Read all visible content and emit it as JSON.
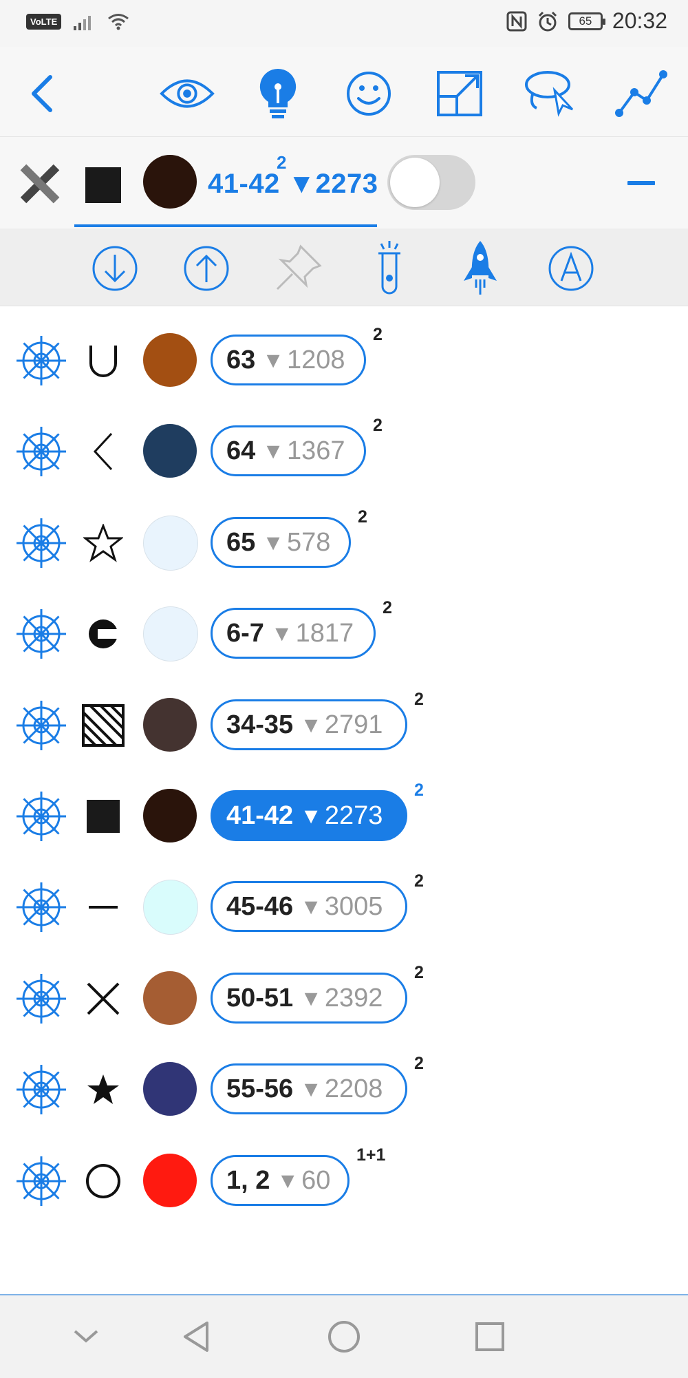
{
  "status_bar": {
    "volte": "VoLTE",
    "battery": "65",
    "time": "20:32"
  },
  "toolbar": {
    "icons": [
      "back-icon",
      "eye-icon",
      "lightbulb-icon",
      "smiley-icon",
      "expand-icon",
      "lasso-icon",
      "graph-icon"
    ]
  },
  "selected": {
    "label": "41-42",
    "count": "2273",
    "sup": "2",
    "symbol": "filled-square",
    "color": "#2a140b",
    "toggle_on": false
  },
  "actionbar": {
    "icons": [
      "arrow-down-circle-icon",
      "arrow-up-circle-icon",
      "pin-icon",
      "test-tube-icon",
      "rocket-icon",
      "letter-a-circle-icon"
    ]
  },
  "rows": [
    {
      "label": "63",
      "count": "1208",
      "sup": "2",
      "symbol": "cup",
      "color": "#a34f12",
      "active": false
    },
    {
      "label": "64",
      "count": "1367",
      "sup": "2",
      "symbol": "chevron-left",
      "color": "#1f3d5f",
      "active": false
    },
    {
      "label": "65",
      "count": "578",
      "sup": "2",
      "symbol": "star-outline",
      "color": "#e9f4fd",
      "active": false
    },
    {
      "label": "6-7",
      "count": "1817",
      "sup": "2",
      "symbol": "half-circle",
      "color": "#e9f4fd",
      "active": false
    },
    {
      "label": "34-35",
      "count": "2791",
      "sup": "2",
      "symbol": "hatched-square",
      "color": "#443330",
      "active": false
    },
    {
      "label": "41-42",
      "count": "2273",
      "sup": "2",
      "symbol": "filled-square",
      "color": "#2a140b",
      "active": true
    },
    {
      "label": "45-46",
      "count": "3005",
      "sup": "2",
      "symbol": "dash",
      "color": "#d9fcfc",
      "active": false
    },
    {
      "label": "50-51",
      "count": "2392",
      "sup": "2",
      "symbol": "cross",
      "color": "#a55d33",
      "active": false
    },
    {
      "label": "55-56",
      "count": "2208",
      "sup": "2",
      "symbol": "star-filled",
      "color": "#303576",
      "active": false
    },
    {
      "label": "1, 2",
      "count": "60",
      "sup": "1+1",
      "symbol": "circle-outline",
      "color": "#ff1a10",
      "active": false
    }
  ],
  "colors": {
    "accent": "#1a7de6"
  }
}
